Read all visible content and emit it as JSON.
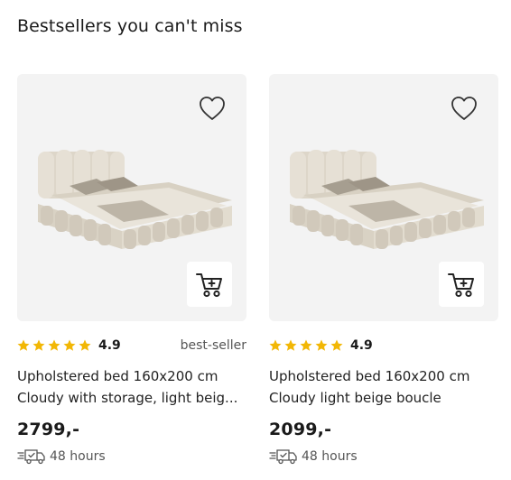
{
  "section": {
    "title": "Bestsellers you can't miss"
  },
  "products": [
    {
      "rating": "4.9",
      "badge": "best-seller",
      "name_line1": "Upholstered bed 160x200 cm",
      "name_line2": "Cloudy with storage, light beig...",
      "price": "2799,-",
      "delivery": "48 hours"
    },
    {
      "rating": "4.9",
      "badge": "",
      "name_line1": "Upholstered bed 160x200 cm",
      "name_line2": "Cloudy light beige boucle",
      "price": "2099,-",
      "delivery": "48 hours"
    }
  ],
  "colors": {
    "star": "#f2b705",
    "card_bg": "#f3f3f3",
    "bed": "#e4ded2"
  },
  "icons": [
    "heart-icon",
    "add-to-cart-icon",
    "star-icon",
    "truck-icon"
  ]
}
